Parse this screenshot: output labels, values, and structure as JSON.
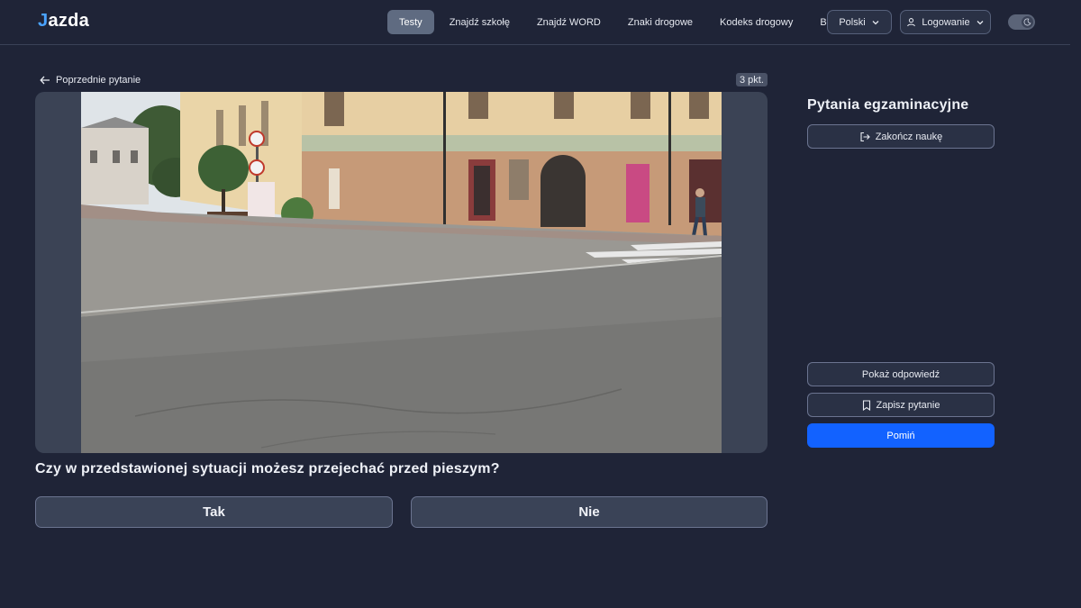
{
  "header": {
    "logo_j": "J",
    "logo_rest": "azda",
    "nav": [
      {
        "label": "Testy",
        "active": true
      },
      {
        "label": "Znajdź szkołę",
        "active": false
      },
      {
        "label": "Znajdź WORD",
        "active": false
      },
      {
        "label": "Znaki drogowe",
        "active": false
      },
      {
        "label": "Kodeks drogowy",
        "active": false
      },
      {
        "label": "Blog",
        "active": false
      }
    ],
    "language": "Polski",
    "login": "Logowanie"
  },
  "main": {
    "prev_label": "Poprzednie pytanie",
    "points": "3 pkt.",
    "question": "Czy w przedstawionej sytuacji możesz przejechać przed pieszym?",
    "answers": {
      "yes": "Tak",
      "no": "Nie"
    }
  },
  "sidebar": {
    "title": "Pytania egzaminacyjne",
    "end_label": "Zakończ naukę",
    "show_answer_label": "Pokaż odpowiedź",
    "save_label": "Zapisz pytanie",
    "skip_label": "Pomiń"
  },
  "colors": {
    "background": "#1f2437",
    "accent": "#1262ff",
    "active_nav": "#5f6b81"
  }
}
